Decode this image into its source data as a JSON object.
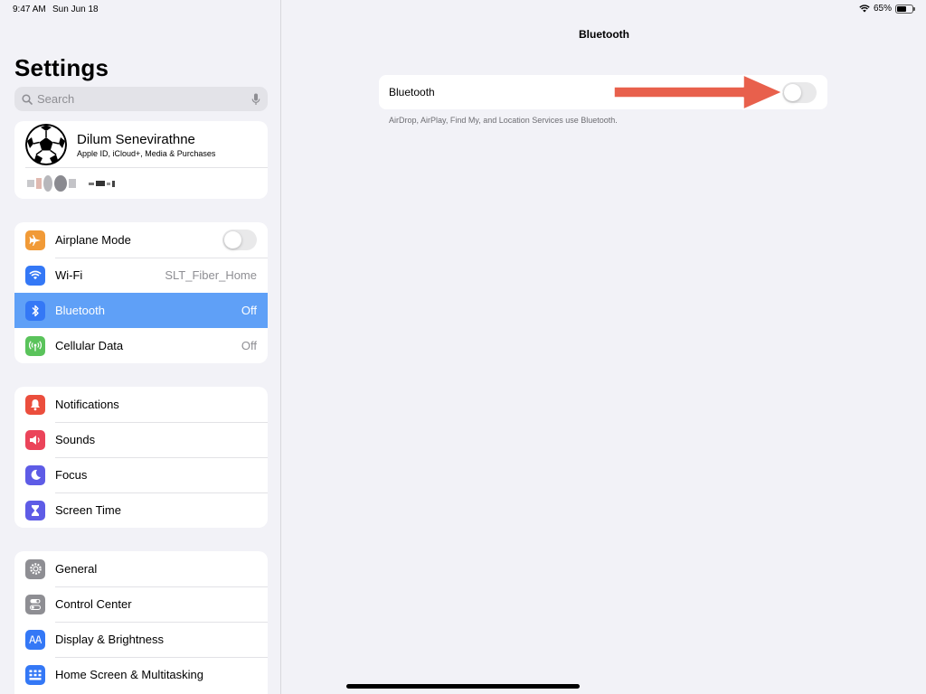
{
  "status_bar": {
    "time": "9:47 AM",
    "date": "Sun Jun 18",
    "battery_percent_label": "65%",
    "battery_level": 0.65
  },
  "sidebar": {
    "title": "Settings",
    "search": {
      "placeholder": "Search"
    },
    "profile": {
      "name": "Dilum Senevirathne",
      "subtitle": "Apple ID, iCloud+, Media & Purchases"
    },
    "connectivity": [
      {
        "label": "Airplane Mode",
        "icon": "airplane-icon",
        "color": "#f19a37",
        "toggle": false
      },
      {
        "label": "Wi-Fi",
        "icon": "wifi-icon",
        "color": "#3478f6",
        "value": "SLT_Fiber_Home"
      },
      {
        "label": "Bluetooth",
        "icon": "bluetooth-icon",
        "color": "#3478f6",
        "value": "Off",
        "selected": true
      },
      {
        "label": "Cellular Data",
        "icon": "cellular-icon",
        "color": "#5ac35b",
        "value": "Off"
      }
    ],
    "alerts": [
      {
        "label": "Notifications",
        "icon": "notifications-icon",
        "color": "#eb4e3d"
      },
      {
        "label": "Sounds",
        "icon": "sounds-icon",
        "color": "#eb445a"
      },
      {
        "label": "Focus",
        "icon": "focus-moon-icon",
        "color": "#5e5ce6"
      },
      {
        "label": "Screen Time",
        "icon": "hourglass-icon",
        "color": "#5e5ce6"
      }
    ],
    "system": [
      {
        "label": "General",
        "icon": "gear-icon",
        "color": "#8e8e93"
      },
      {
        "label": "Control Center",
        "icon": "control-center-icon",
        "color": "#8e8e93"
      },
      {
        "label": "Display & Brightness",
        "icon": "display-icon",
        "color": "#3478f6"
      },
      {
        "label": "Home Screen & Multitasking",
        "icon": "home-screen-icon",
        "color": "#3478f6"
      }
    ]
  },
  "detail": {
    "title": "Bluetooth",
    "bluetooth_label": "Bluetooth",
    "bluetooth_on": false,
    "footer": "AirDrop, AirPlay, Find My, and Location Services use Bluetooth."
  },
  "colors": {
    "accent": "#3478f6",
    "selected_row": "#5fa0f7",
    "annotation_arrow": "#e8604c",
    "background": "#f2f2f7"
  }
}
